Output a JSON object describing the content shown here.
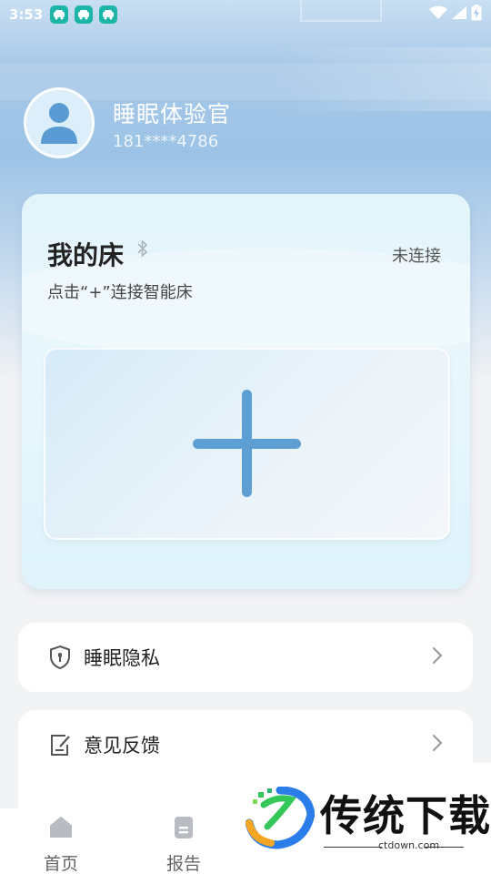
{
  "status_bar": {
    "time": "3:53",
    "notification_icons": [
      "app-notification-icon",
      "app-notification-icon",
      "app-notification-icon"
    ],
    "icons": [
      "wifi-icon",
      "signal-icon",
      "battery-icon"
    ]
  },
  "profile": {
    "name": "睡眠体验官",
    "phone": "181****4786"
  },
  "bed_card": {
    "title": "我的床",
    "status": "未连接",
    "hint": "点击“+”连接智能床"
  },
  "menu": [
    {
      "label": "睡眠隐私",
      "icon": "shield-icon"
    },
    {
      "label": "意见反馈",
      "icon": "feedback-edit-icon"
    }
  ],
  "bottom_nav": {
    "items": [
      {
        "label": "首页",
        "icon": "home-icon"
      },
      {
        "label": "报告",
        "icon": "report-icon"
      }
    ]
  },
  "watermark": {
    "text": "传统下载",
    "url": "ctdown.com"
  },
  "colors": {
    "accent": "#5d9fd3",
    "status_bar_icon_bg": "#1db5a8"
  }
}
